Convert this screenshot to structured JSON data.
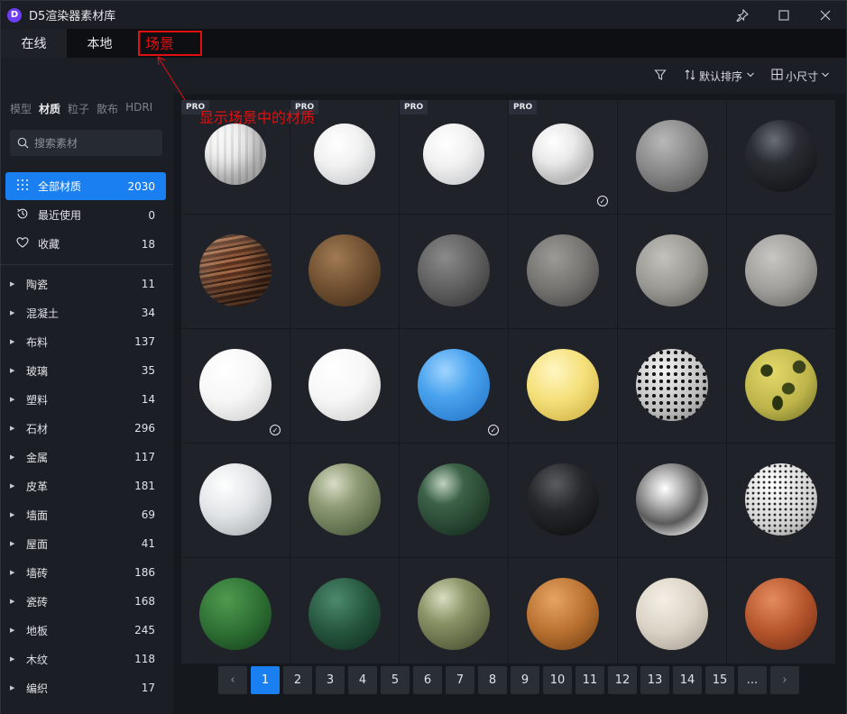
{
  "window": {
    "title": "D5渲染器素材库",
    "logo_letter": "D",
    "pin_icon": "pin-icon",
    "minimize_icon": "maximize-icon",
    "close_icon": "close-icon"
  },
  "tabs": [
    {
      "label": "在线",
      "active": true
    },
    {
      "label": "本地",
      "active": false
    },
    {
      "label": "场景",
      "active": false
    }
  ],
  "annotations": {
    "box_label": "场景",
    "note": "显示场景中的材质",
    "color": "#e01010"
  },
  "toolbar": {
    "filter_icon": "filter-icon",
    "sort_label": "默认排序",
    "size_label": "小尺寸"
  },
  "sidebar": {
    "categories": [
      "模型",
      "材质",
      "粒子",
      "散布",
      "HDRI"
    ],
    "active_category": "材质",
    "search_placeholder": "搜索素材",
    "main_items": [
      {
        "label": "全部材质",
        "count": "2030",
        "icon": "grid-dots-icon",
        "active": true
      },
      {
        "label": "最近使用",
        "count": "0",
        "icon": "history-icon",
        "active": false
      },
      {
        "label": "收藏",
        "count": "18",
        "icon": "heart-icon",
        "active": false
      }
    ],
    "tree": [
      {
        "label": "陶瓷",
        "count": "11"
      },
      {
        "label": "混凝土",
        "count": "34"
      },
      {
        "label": "布料",
        "count": "137"
      },
      {
        "label": "玻璃",
        "count": "35"
      },
      {
        "label": "塑料",
        "count": "14"
      },
      {
        "label": "石材",
        "count": "296"
      },
      {
        "label": "金属",
        "count": "117"
      },
      {
        "label": "皮革",
        "count": "181"
      },
      {
        "label": "墙面",
        "count": "69"
      },
      {
        "label": "屋面",
        "count": "41"
      },
      {
        "label": "墙砖",
        "count": "186"
      },
      {
        "label": "瓷砖",
        "count": "168"
      },
      {
        "label": "地板",
        "count": "245"
      },
      {
        "label": "木纹",
        "count": "118"
      },
      {
        "label": "编织",
        "count": "17"
      }
    ]
  },
  "materials": [
    {
      "style": "m-stripe",
      "pro": "PRO",
      "check": false,
      "small": true
    },
    {
      "style": "m-white-soft",
      "pro": "PRO",
      "check": false,
      "small": true
    },
    {
      "style": "m-white-soft",
      "pro": "PRO",
      "check": false,
      "small": true
    },
    {
      "style": "m-glass",
      "pro": "PRO",
      "check": true,
      "small": true
    },
    {
      "style": "m-grey-stone",
      "pro": "",
      "check": false,
      "small": false
    },
    {
      "style": "m-black",
      "pro": "",
      "check": false,
      "small": false
    },
    {
      "style": "m-wood",
      "pro": "",
      "check": false,
      "small": false
    },
    {
      "style": "m-brown",
      "pro": "",
      "check": false,
      "small": false
    },
    {
      "style": "m-concrete-d",
      "pro": "",
      "check": false,
      "small": false
    },
    {
      "style": "m-concrete-m",
      "pro": "",
      "check": false,
      "small": false
    },
    {
      "style": "m-concrete-l",
      "pro": "",
      "check": false,
      "small": false
    },
    {
      "style": "m-concrete-w",
      "pro": "",
      "check": false,
      "small": false
    },
    {
      "style": "m-white-gloss",
      "pro": "",
      "check": true,
      "small": false
    },
    {
      "style": "m-white-gloss",
      "pro": "",
      "check": false,
      "small": false
    },
    {
      "style": "m-blue",
      "pro": "",
      "check": true,
      "small": false
    },
    {
      "style": "m-yellow",
      "pro": "",
      "check": false,
      "small": false
    },
    {
      "style": "m-perf",
      "pro": "",
      "check": false,
      "small": false
    },
    {
      "style": "m-camo",
      "pro": "",
      "check": false,
      "small": false
    },
    {
      "style": "m-marble",
      "pro": "",
      "check": false,
      "small": false
    },
    {
      "style": "m-green-tile",
      "pro": "",
      "check": false,
      "small": false
    },
    {
      "style": "m-green-dark",
      "pro": "",
      "check": false,
      "small": false
    },
    {
      "style": "m-black-matte",
      "pro": "",
      "check": false,
      "small": false
    },
    {
      "style": "m-chrome",
      "pro": "",
      "check": false,
      "small": false
    },
    {
      "style": "m-perf2",
      "pro": "",
      "check": false,
      "small": false
    },
    {
      "style": "m-green-fabric",
      "pro": "",
      "check": false,
      "small": false
    },
    {
      "style": "m-green-leather",
      "pro": "",
      "check": false,
      "small": false
    },
    {
      "style": "m-olive",
      "pro": "",
      "check": false,
      "small": false
    },
    {
      "style": "m-orange-leather",
      "pro": "",
      "check": false,
      "small": false
    },
    {
      "style": "m-cream",
      "pro": "",
      "check": false,
      "small": false
    },
    {
      "style": "m-rust",
      "pro": "",
      "check": false,
      "small": false
    }
  ],
  "pager": {
    "prev": "‹",
    "pages": [
      "1",
      "2",
      "3",
      "4",
      "5",
      "6",
      "7",
      "8",
      "9",
      "10",
      "11",
      "12",
      "13",
      "14",
      "15",
      "..."
    ],
    "current": "1",
    "next": "›"
  },
  "colors": {
    "accent": "#1a7ff0",
    "background": "#16191e"
  }
}
